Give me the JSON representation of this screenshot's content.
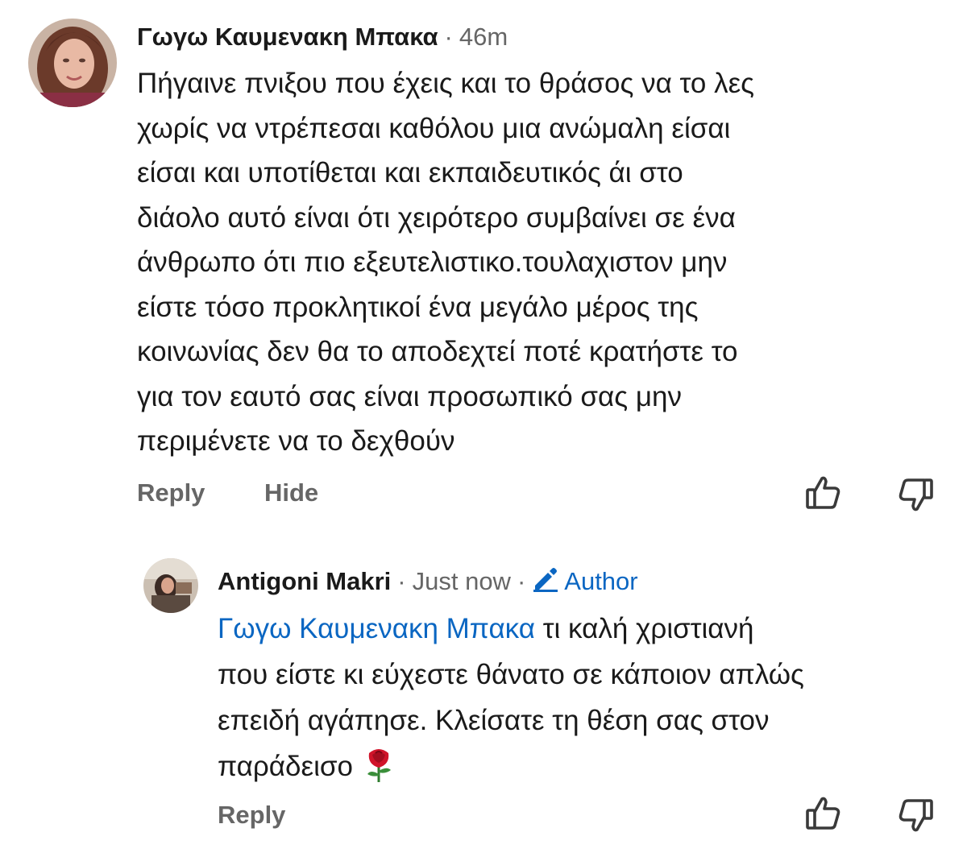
{
  "comments": [
    {
      "author": "Γωγω Καυμενακη Μπακα",
      "separator": "·",
      "time": "46m",
      "lines": [
        "Πήγαινε πνιξου που έχεις και το θράσος να το λες",
        "χωρίς να ντρέπεσαι καθόλου μια ανώμαλη είσαι",
        "είσαι και υποτίθεται και εκπαιδευτικός άι στο",
        "διάολο αυτό είναι ότι χειρότερο συμβαίνει σε ένα",
        "άνθρωπο ότι πιο εξευτελιστικο.τουλαχιστον μην",
        "είστε τόσο προκλητικοί ένα μεγάλο μέρος της",
        "κοινωνίας δεν θα το αποδεχτεί ποτέ κρατήστε το",
        "για τον εαυτό σας είναι προσωπικό σας μην",
        "περιμένετε να το δεχθούν"
      ],
      "actions": {
        "reply": "Reply",
        "hide": "Hide"
      },
      "icons": {
        "like": "thumbs-up-icon",
        "dislike": "thumbs-down-icon"
      }
    }
  ],
  "reply": {
    "author": "Antigoni Makri",
    "separator": "·",
    "time": "Just now",
    "separator2": "·",
    "badge": "Author",
    "badge_icon": "pencil-icon",
    "mention": "Γωγω Καυμενακη Μπακα",
    "line1_rest": " τι καλή χριστιανή",
    "lines": [
      "που είστε κι εύχεστε θάνατο σε κάποιον απλώς",
      "επειδή αγάπησε. Κλείσατε τη θέση σας στον"
    ],
    "last_line": "παράδεισο ",
    "emoji": "rose-icon",
    "actions": {
      "reply": "Reply"
    },
    "icons": {
      "like": "thumbs-up-icon",
      "dislike": "thumbs-down-icon"
    }
  },
  "colors": {
    "link": "#0a66c2",
    "muted": "#666666",
    "text": "#1a1a1a"
  }
}
